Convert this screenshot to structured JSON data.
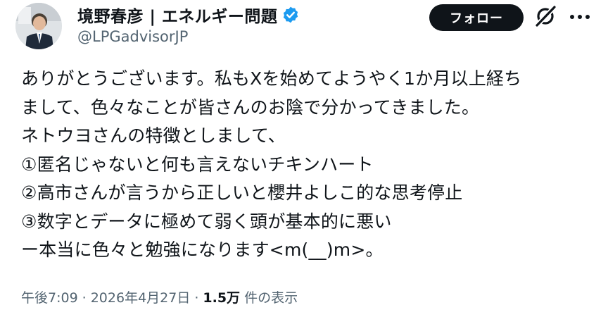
{
  "header": {
    "display_name": "境野春彦 | エネルギー問題",
    "handle": "@LPGadvisorJP",
    "follow_label": "フォロー",
    "verified_icon": "verified-badge-icon",
    "grok_icon": "grok-icon",
    "more_icon": "more-icon"
  },
  "tweet": {
    "lines": [
      "ありがとうございます。私もXを始めてようやく1か月以上経ち",
      "まして、色々なことが皆さんのお陰で分かってきました。",
      "ネトウヨさんの特徴としまして、",
      "①匿名じゃないと何も言えないチキンハート",
      "②高市さんが言うから正しいと櫻井よしこ的な思考停止",
      "③数字とデータに極めて弱く頭が基本的に悪い",
      "ー本当に色々と勉強になります<m(__)m>。"
    ]
  },
  "meta": {
    "time": "午後7:09",
    "separator": "·",
    "date": "2026年4月27日",
    "views_count": "1.5万",
    "views_label": "件の表示"
  },
  "colors": {
    "text": "#0f1419",
    "secondary": "#536471",
    "verified": "#1d9bf0",
    "button_bg": "#0f1419"
  }
}
